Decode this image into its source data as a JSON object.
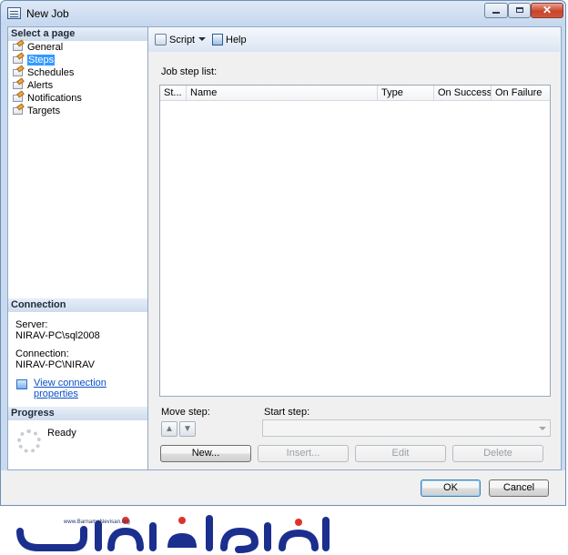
{
  "window": {
    "title": "New Job"
  },
  "sidebar": {
    "select_page_header": "Select a page",
    "items": [
      {
        "label": "General",
        "selected": false
      },
      {
        "label": "Steps",
        "selected": true
      },
      {
        "label": "Schedules",
        "selected": false
      },
      {
        "label": "Alerts",
        "selected": false
      },
      {
        "label": "Notifications",
        "selected": false
      },
      {
        "label": "Targets",
        "selected": false
      }
    ],
    "connection_header": "Connection",
    "server_label": "Server:",
    "server_value": "NIRAV-PC\\sql2008",
    "connection_label": "Connection:",
    "connection_value": "NIRAV-PC\\NIRAV",
    "view_connection_link": "View connection properties",
    "progress_header": "Progress",
    "progress_status": "Ready"
  },
  "toolbar": {
    "script_label": "Script",
    "help_label": "Help"
  },
  "main": {
    "job_step_list_label": "Job step list:",
    "columns": [
      "St...",
      "Name",
      "Type",
      "On Success",
      "On Failure"
    ],
    "rows": [],
    "move_step_label": "Move step:",
    "start_step_label": "Start step:",
    "start_step_value": "",
    "buttons": {
      "new": "New...",
      "insert": "Insert...",
      "edit": "Edit",
      "delete": "Delete"
    }
  },
  "footer": {
    "ok": "OK",
    "cancel": "Cancel"
  },
  "watermark": {
    "url": "www.BarnameNevisan.org",
    "logo_text": "برنامه نویسان"
  },
  "colors": {
    "selection": "#3399ff",
    "link": "#0b4fc6",
    "logo_blue": "#1b2f8f",
    "logo_red": "#e0322b"
  }
}
